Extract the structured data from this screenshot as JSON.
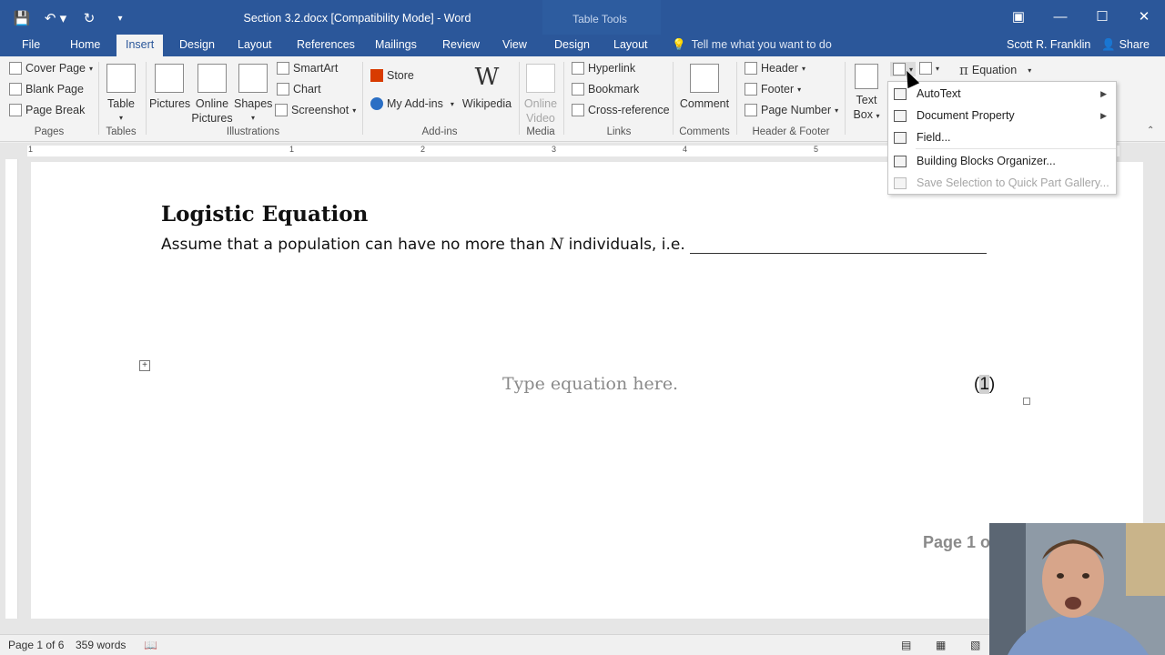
{
  "window": {
    "title": "Section 3.2.docx [Compatibility Mode] - Word",
    "contextual_tab_group": "Table Tools"
  },
  "qat": {
    "save_icon": "save-icon",
    "undo_icon": "undo-icon",
    "redo_icon": "redo-icon"
  },
  "tabs": [
    "File",
    "Home",
    "Insert",
    "Design",
    "Layout",
    "References",
    "Mailings",
    "Review",
    "View",
    "Design",
    "Layout"
  ],
  "active_tab": "Insert",
  "tell_me": "Tell me what you want to do",
  "user": "Scott R. Franklin",
  "share": "Share",
  "ribbon": {
    "pages": {
      "cover_page": "Cover Page",
      "blank_page": "Blank Page",
      "page_break": "Page Break",
      "group": "Pages"
    },
    "tables": {
      "table": "Table",
      "group": "Tables"
    },
    "illustrations": {
      "pictures": "Pictures",
      "online_pictures_1": "Online",
      "online_pictures_2": "Pictures",
      "shapes": "Shapes",
      "smartart": "SmartArt",
      "chart": "Chart",
      "screenshot": "Screenshot",
      "group": "Illustrations"
    },
    "addins": {
      "store": "Store",
      "my_addins": "My Add-ins",
      "wikipedia": "Wikipedia",
      "group": "Add-ins"
    },
    "media": {
      "online_video_1": "Online",
      "online_video_2": "Video",
      "group": "Media"
    },
    "links": {
      "hyperlink": "Hyperlink",
      "bookmark": "Bookmark",
      "cross_reference": "Cross-reference",
      "group": "Links"
    },
    "comments": {
      "comment": "Comment",
      "group": "Comments"
    },
    "header_footer": {
      "header": "Header",
      "footer": "Footer",
      "page_number": "Page Number",
      "group": "Header & Footer"
    },
    "text": {
      "text_box_1": "Text",
      "text_box_2": "Box"
    },
    "symbols": {
      "equation": "Equation"
    }
  },
  "quick_parts_menu": {
    "items": [
      {
        "label": "AutoText",
        "submenu": true,
        "enabled": true
      },
      {
        "label": "Document Property",
        "submenu": true,
        "enabled": true
      },
      {
        "label": "Field...",
        "submenu": false,
        "enabled": true
      },
      {
        "label": "Building Blocks Organizer...",
        "submenu": false,
        "enabled": true
      },
      {
        "label": "Save Selection to Quick Part Gallery...",
        "submenu": false,
        "enabled": false
      }
    ]
  },
  "ruler": {
    "numbers": [
      "1",
      "1",
      "2",
      "3",
      "4",
      "5"
    ]
  },
  "document": {
    "heading": "Logistic Equation",
    "paragraph_text": "Assume that a population can have no more than",
    "variable": "N",
    "paragraph_tail": "individuals, i.e.",
    "equation_placeholder": "Type equation here.",
    "equation_number": "(1)",
    "eq_open": "(",
    "eq_digit": "1",
    "eq_close": ")",
    "footer_text": "Page 1 o"
  },
  "statusbar": {
    "page": "Page 1 of 6",
    "words": "359 words"
  },
  "colors": {
    "word_blue": "#2b579a",
    "ribbon_bg": "#f3f3f3"
  }
}
